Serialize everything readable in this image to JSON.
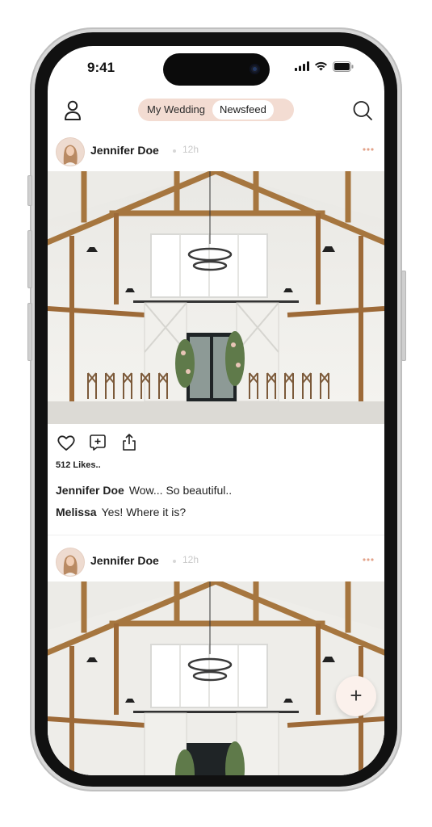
{
  "status_bar": {
    "time": "9:41"
  },
  "header": {
    "tabs": [
      {
        "label": "My Wedding",
        "active": false
      },
      {
        "label": "Newsfeed",
        "active": true
      }
    ]
  },
  "posts": [
    {
      "author": "Jennifer Doe",
      "time": "12h",
      "likes": "512 Likes..",
      "comments": [
        {
          "author": "Jennifer Doe",
          "text": "Wow... So beautiful.."
        },
        {
          "author": "Melissa",
          "text": "Yes! Where it is?"
        }
      ]
    },
    {
      "author": "Jennifer Doe",
      "time": "12h"
    }
  ],
  "fab": {
    "label": "+"
  },
  "colors": {
    "accent_tab_bg": "#f3dcd2",
    "more_dots": "#e3a38b",
    "fab_bg": "#fbf1ec",
    "wood": "#9a6b3d"
  },
  "icons": [
    "profile-icon",
    "search-icon",
    "heart-icon",
    "add-comment-icon",
    "share-icon",
    "more-icon",
    "plus-icon"
  ]
}
